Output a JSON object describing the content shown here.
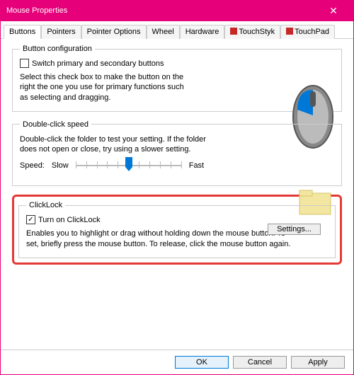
{
  "title": "Mouse Properties",
  "tabs": [
    "Buttons",
    "Pointers",
    "Pointer Options",
    "Wheel",
    "Hardware",
    "TouchStyk",
    "TouchPad"
  ],
  "active_tab": "Buttons",
  "button_config": {
    "legend": "Button configuration",
    "checkbox_label": "Switch primary and secondary buttons",
    "checked": false,
    "desc": "Select this check box to make the button on the right the one you use for primary functions such as selecting and dragging."
  },
  "double_click": {
    "legend": "Double-click speed",
    "desc": "Double-click the folder to test your setting. If the folder does not open or close, try using a slower setting.",
    "speed_label": "Speed:",
    "slow_label": "Slow",
    "fast_label": "Fast"
  },
  "clicklock": {
    "legend": "ClickLock",
    "checkbox_label": "Turn on ClickLock",
    "checked": true,
    "settings_btn": "Settings...",
    "desc": "Enables you to highlight or drag without holding down the mouse button. To set, briefly press the mouse button. To release, click the mouse button again."
  },
  "footer": {
    "ok": "OK",
    "cancel": "Cancel",
    "apply": "Apply"
  }
}
